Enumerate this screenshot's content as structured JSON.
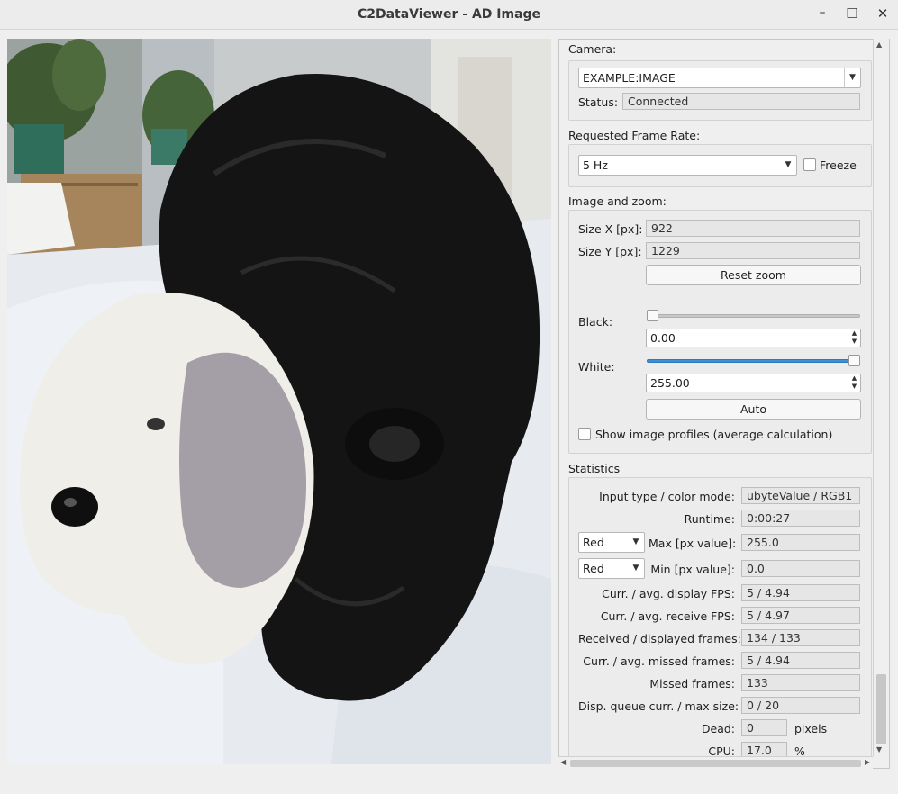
{
  "window": {
    "title": "C2DataViewer - AD Image",
    "minimize_icon": "minimize-icon",
    "maximize_icon": "maximize-icon",
    "close_icon": "close-icon"
  },
  "camera": {
    "group_label": "Camera:",
    "pv_value": "EXAMPLE:IMAGE",
    "status_label": "Status:",
    "status_value": "Connected"
  },
  "frame_rate": {
    "group_label": "Requested Frame Rate:",
    "value": "5 Hz",
    "freeze_label": "Freeze",
    "freeze_checked": false
  },
  "image_zoom": {
    "group_label": "Image and zoom:",
    "size_x_label": "Size X [px]:",
    "size_x_value": "922",
    "size_y_label": "Size Y [px]:",
    "size_y_value": "1229",
    "reset_zoom_label": "Reset zoom",
    "black_label": "Black:",
    "black_value": "0.00",
    "black_level": 0.0,
    "white_label": "White:",
    "white_value": "255.00",
    "white_level": 1.0,
    "auto_label": "Auto",
    "profiles_label": "Show image profiles (average calculation)",
    "profiles_checked": false
  },
  "statistics": {
    "group_label": "Statistics",
    "input_type_label": "Input type / color mode:",
    "input_type_value": "ubyteValue / RGB1",
    "runtime_label": "Runtime:",
    "runtime_value": "0:00:27",
    "max_channel": "Red",
    "max_label": "Max [px value]:",
    "max_value": "255.0",
    "min_channel": "Red",
    "min_label": "Min [px value]:",
    "min_value": "0.0",
    "display_fps_label": "Curr. / avg. display FPS:",
    "display_fps_value": "5 / 4.94",
    "receive_fps_label": "Curr. / avg. receive FPS:",
    "receive_fps_value": "5 / 4.97",
    "frames_label": "Received / displayed frames:",
    "frames_value": "134 / 133",
    "missed_fps_label": "Curr. / avg. missed frames:",
    "missed_fps_value": "5 / 4.94",
    "missed_label": "Missed frames:",
    "missed_value": "133",
    "queue_label": "Disp. queue curr. / max size:",
    "queue_value": "0 / 20",
    "dead_label": "Dead:",
    "dead_value": "0",
    "dead_unit": "pixels",
    "cpu_label": "CPU:",
    "cpu_value": "17.0",
    "cpu_unit": "%"
  },
  "colors": {
    "slider_fill": "#3d8fd6",
    "field_bg": "#e6e6e6"
  }
}
